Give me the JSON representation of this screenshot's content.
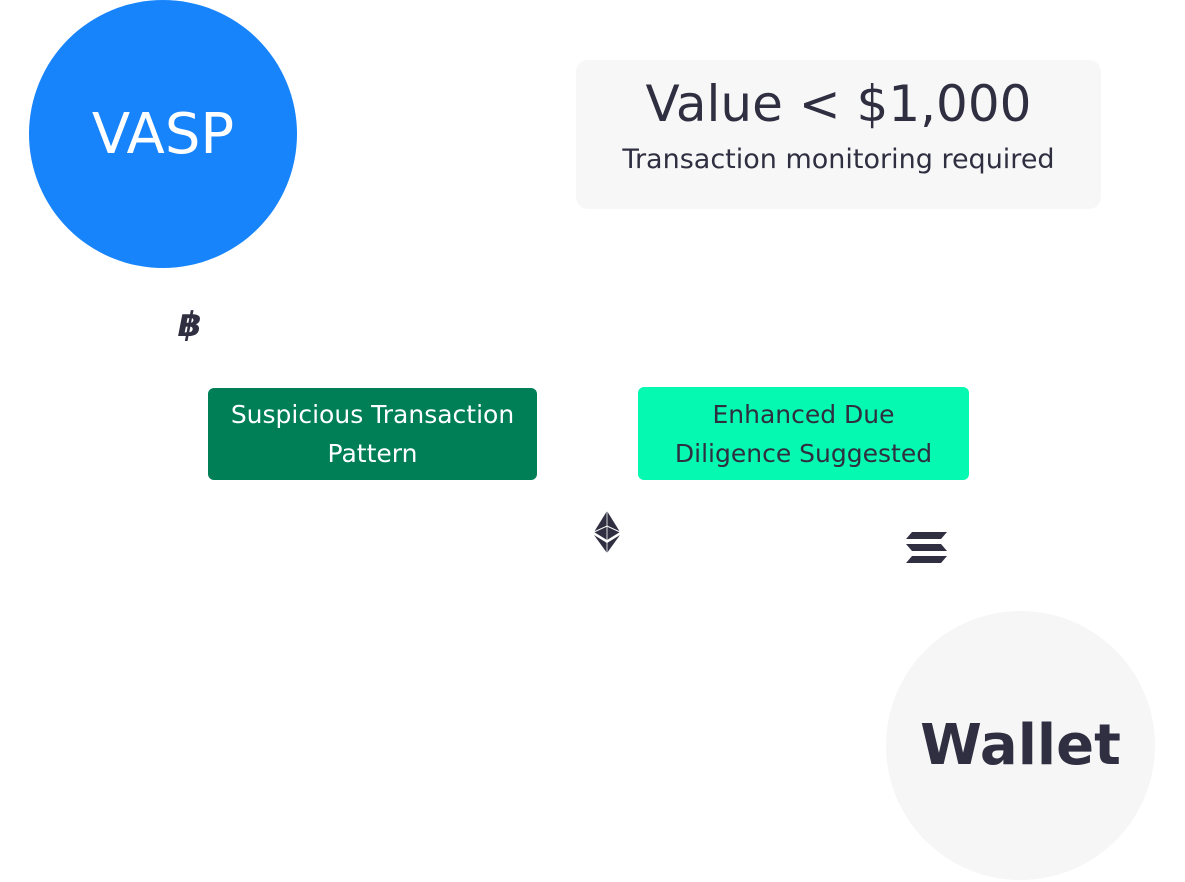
{
  "nodes": {
    "vasp": "VASP",
    "wallet": "Wallet"
  },
  "value_box": {
    "title": "Value < $1,000",
    "subtitle": "Transaction monitoring required"
  },
  "tags": {
    "suspicious": "Suspicious Transaction Pattern",
    "edd": "Enhanced Due Diligence Suggested"
  },
  "icons": [
    "bitcoin-icon",
    "ethereum-icon",
    "solana-icon"
  ],
  "colors": {
    "vasp": "#1784fb",
    "suspicious": "#007f56",
    "edd": "#05f9b0",
    "text": "#2f2f41"
  }
}
